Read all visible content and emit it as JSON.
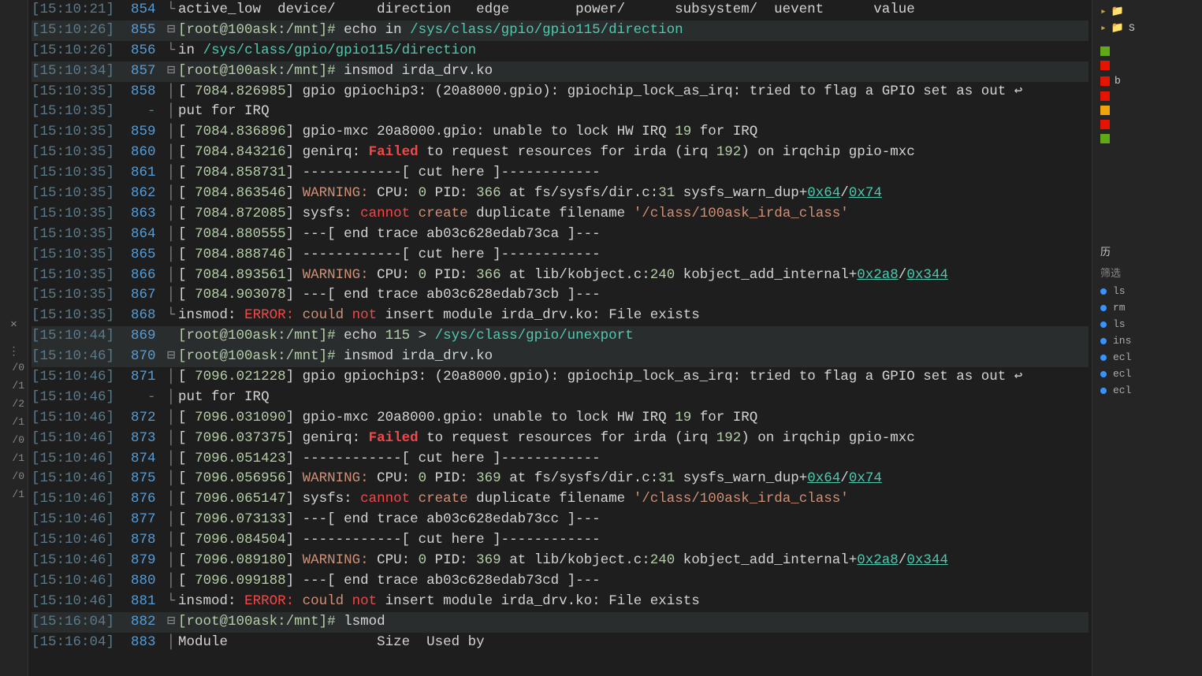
{
  "leftbar": {
    "close": "✕",
    "dots": "⋮",
    "items": [
      "/0",
      "/1",
      "/2",
      "/1",
      "/0",
      "/1",
      "/0",
      "/1"
    ]
  },
  "lines": [
    {
      "ts": "[15:10:21]",
      "ln": "854",
      "fold": "└",
      "segs": [
        {
          "t": "active_low  device/     direction   edge        power/      subsystem/  uevent      value",
          "c": "cmd"
        }
      ]
    },
    {
      "ts": "[15:10:26]",
      "ln": "855",
      "fold": "⊟",
      "hl": true,
      "segs": [
        {
          "t": "[root@100ask:/mnt]#",
          "c": "prompt"
        },
        {
          "t": " echo in ",
          "c": "cmd"
        },
        {
          "t": "/sys/class/gpio/gpio115/direction",
          "c": "path"
        }
      ]
    },
    {
      "ts": "[15:10:26]",
      "ln": "856",
      "fold": "└",
      "segs": [
        {
          "t": "in ",
          "c": "cmd"
        },
        {
          "t": "/sys/class/gpio/gpio115/direction",
          "c": "path"
        }
      ]
    },
    {
      "ts": "[15:10:34]",
      "ln": "857",
      "fold": "⊟",
      "hl": true,
      "segs": [
        {
          "t": "[root@100ask:/mnt]#",
          "c": "prompt"
        },
        {
          "t": " insmod irda_drv.ko",
          "c": "cmd"
        }
      ]
    },
    {
      "ts": "[15:10:35]",
      "ln": "858",
      "fold": "│",
      "segs": [
        {
          "t": "[ ",
          "c": "cmd"
        },
        {
          "t": "7084.826985",
          "c": "n"
        },
        {
          "t": "] gpio gpiochip3: (20a8000.gpio): gpiochip_lock_as_irq: tried to flag a GPIO set as out ↩",
          "c": "cmd"
        }
      ]
    },
    {
      "ts": "[15:10:35]",
      "ln": "-",
      "fold": "│",
      "segs": [
        {
          "t": "put for IRQ",
          "c": "cmd"
        }
      ]
    },
    {
      "ts": "[15:10:35]",
      "ln": "859",
      "fold": "│",
      "segs": [
        {
          "t": "[ ",
          "c": "cmd"
        },
        {
          "t": "7084.836896",
          "c": "n"
        },
        {
          "t": "] gpio-mxc 20a8000.gpio: unable to lock HW IRQ ",
          "c": "cmd"
        },
        {
          "t": "19",
          "c": "n"
        },
        {
          "t": " for IRQ",
          "c": "cmd"
        }
      ]
    },
    {
      "ts": "[15:10:35]",
      "ln": "860",
      "fold": "│",
      "segs": [
        {
          "t": "[ ",
          "c": "cmd"
        },
        {
          "t": "7084.843216",
          "c": "n"
        },
        {
          "t": "] genirq: ",
          "c": "cmd"
        },
        {
          "t": "Failed",
          "c": "kw-fail"
        },
        {
          "t": " to request resources for irda (irq ",
          "c": "cmd"
        },
        {
          "t": "192",
          "c": "n"
        },
        {
          "t": ") on irqchip gpio-mxc",
          "c": "cmd"
        }
      ]
    },
    {
      "ts": "[15:10:35]",
      "ln": "861",
      "fold": "│",
      "segs": [
        {
          "t": "[ ",
          "c": "cmd"
        },
        {
          "t": "7084.858731",
          "c": "n"
        },
        {
          "t": "] ------------[ cut here ]------------",
          "c": "cmd"
        }
      ]
    },
    {
      "ts": "[15:10:35]",
      "ln": "862",
      "fold": "│",
      "segs": [
        {
          "t": "[ ",
          "c": "cmd"
        },
        {
          "t": "7084.863546",
          "c": "n"
        },
        {
          "t": "] ",
          "c": "cmd"
        },
        {
          "t": "WARNING:",
          "c": "kw-warn"
        },
        {
          "t": " CPU: ",
          "c": "cmd"
        },
        {
          "t": "0",
          "c": "n"
        },
        {
          "t": " PID: ",
          "c": "cmd"
        },
        {
          "t": "366",
          "c": "n"
        },
        {
          "t": " at fs/sysfs/dir.c:",
          "c": "cmd"
        },
        {
          "t": "31",
          "c": "n"
        },
        {
          "t": " sysfs_warn_dup+",
          "c": "cmd"
        },
        {
          "t": "0x64",
          "c": "addr"
        },
        {
          "t": "/",
          "c": "cmd"
        },
        {
          "t": "0x74",
          "c": "addr"
        }
      ]
    },
    {
      "ts": "[15:10:35]",
      "ln": "863",
      "fold": "│",
      "segs": [
        {
          "t": "[ ",
          "c": "cmd"
        },
        {
          "t": "7084.872085",
          "c": "n"
        },
        {
          "t": "] sysfs: ",
          "c": "cmd"
        },
        {
          "t": "cannot",
          "c": "kw-cannot"
        },
        {
          "t": " ",
          "c": "cmd"
        },
        {
          "t": "create",
          "c": "kw-create"
        },
        {
          "t": " duplicate filename ",
          "c": "cmd"
        },
        {
          "t": "'/class/100ask_irda_class'",
          "c": "str"
        }
      ]
    },
    {
      "ts": "[15:10:35]",
      "ln": "864",
      "fold": "│",
      "segs": [
        {
          "t": "[ ",
          "c": "cmd"
        },
        {
          "t": "7084.880555",
          "c": "n"
        },
        {
          "t": "] ---[ end trace ab03c628edab73ca ]---",
          "c": "cmd"
        }
      ]
    },
    {
      "ts": "[15:10:35]",
      "ln": "865",
      "fold": "│",
      "segs": [
        {
          "t": "[ ",
          "c": "cmd"
        },
        {
          "t": "7084.888746",
          "c": "n"
        },
        {
          "t": "] ------------[ cut here ]------------",
          "c": "cmd"
        }
      ]
    },
    {
      "ts": "[15:10:35]",
      "ln": "866",
      "fold": "│",
      "segs": [
        {
          "t": "[ ",
          "c": "cmd"
        },
        {
          "t": "7084.893561",
          "c": "n"
        },
        {
          "t": "] ",
          "c": "cmd"
        },
        {
          "t": "WARNING:",
          "c": "kw-warn"
        },
        {
          "t": " CPU: ",
          "c": "cmd"
        },
        {
          "t": "0",
          "c": "n"
        },
        {
          "t": " PID: ",
          "c": "cmd"
        },
        {
          "t": "366",
          "c": "n"
        },
        {
          "t": " at lib/kobject.c:",
          "c": "cmd"
        },
        {
          "t": "240",
          "c": "n"
        },
        {
          "t": " kobject_add_internal+",
          "c": "cmd"
        },
        {
          "t": "0x2a8",
          "c": "addr"
        },
        {
          "t": "/",
          "c": "cmd"
        },
        {
          "t": "0x344",
          "c": "addr"
        }
      ]
    },
    {
      "ts": "[15:10:35]",
      "ln": "867",
      "fold": "│",
      "segs": [
        {
          "t": "[ ",
          "c": "cmd"
        },
        {
          "t": "7084.903078",
          "c": "n"
        },
        {
          "t": "] ---[ end trace ab03c628edab73cb ]---",
          "c": "cmd"
        }
      ]
    },
    {
      "ts": "[15:10:35]",
      "ln": "868",
      "fold": "└",
      "segs": [
        {
          "t": "insmod: ",
          "c": "cmd"
        },
        {
          "t": "ERROR:",
          "c": "kw-err"
        },
        {
          "t": " ",
          "c": "cmd"
        },
        {
          "t": "could",
          "c": "kw-could"
        },
        {
          "t": " ",
          "c": "cmd"
        },
        {
          "t": "not",
          "c": "kw-not"
        },
        {
          "t": " insert module irda_drv.ko: File exists",
          "c": "cmd"
        }
      ]
    },
    {
      "ts": "[15:10:44]",
      "ln": "869",
      "fold": " ",
      "hl": true,
      "segs": [
        {
          "t": "[root@100ask:/mnt]#",
          "c": "prompt"
        },
        {
          "t": " echo ",
          "c": "cmd"
        },
        {
          "t": "115",
          "c": "n"
        },
        {
          "t": " > ",
          "c": "cmd"
        },
        {
          "t": "/sys/class/gpio/unexport",
          "c": "path"
        }
      ]
    },
    {
      "ts": "[15:10:46]",
      "ln": "870",
      "fold": "⊟",
      "hl": true,
      "segs": [
        {
          "t": "[root@100ask:/mnt]#",
          "c": "prompt"
        },
        {
          "t": " insmod irda_drv.ko",
          "c": "cmd"
        }
      ]
    },
    {
      "ts": "[15:10:46]",
      "ln": "871",
      "fold": "│",
      "segs": [
        {
          "t": "[ ",
          "c": "cmd"
        },
        {
          "t": "7096.021228",
          "c": "n"
        },
        {
          "t": "] gpio gpiochip3: (20a8000.gpio): gpiochip_lock_as_irq: tried to flag a GPIO set as out ↩",
          "c": "cmd"
        }
      ]
    },
    {
      "ts": "[15:10:46]",
      "ln": "-",
      "fold": "│",
      "segs": [
        {
          "t": "put for IRQ",
          "c": "cmd"
        }
      ]
    },
    {
      "ts": "[15:10:46]",
      "ln": "872",
      "fold": "│",
      "segs": [
        {
          "t": "[ ",
          "c": "cmd"
        },
        {
          "t": "7096.031090",
          "c": "n"
        },
        {
          "t": "] gpio-mxc 20a8000.gpio: unable to lock HW IRQ ",
          "c": "cmd"
        },
        {
          "t": "19",
          "c": "n"
        },
        {
          "t": " for IRQ",
          "c": "cmd"
        }
      ]
    },
    {
      "ts": "[15:10:46]",
      "ln": "873",
      "fold": "│",
      "segs": [
        {
          "t": "[ ",
          "c": "cmd"
        },
        {
          "t": "7096.037375",
          "c": "n"
        },
        {
          "t": "] genirq: ",
          "c": "cmd"
        },
        {
          "t": "Failed",
          "c": "kw-fail"
        },
        {
          "t": " to request resources for irda (irq ",
          "c": "cmd"
        },
        {
          "t": "192",
          "c": "n"
        },
        {
          "t": ") on irqchip gpio-mxc",
          "c": "cmd"
        }
      ]
    },
    {
      "ts": "[15:10:46]",
      "ln": "874",
      "fold": "│",
      "segs": [
        {
          "t": "[ ",
          "c": "cmd"
        },
        {
          "t": "7096.051423",
          "c": "n"
        },
        {
          "t": "] ------------[ cut here ]------------",
          "c": "cmd"
        }
      ]
    },
    {
      "ts": "[15:10:46]",
      "ln": "875",
      "fold": "│",
      "segs": [
        {
          "t": "[ ",
          "c": "cmd"
        },
        {
          "t": "7096.056956",
          "c": "n"
        },
        {
          "t": "] ",
          "c": "cmd"
        },
        {
          "t": "WARNING:",
          "c": "kw-warn"
        },
        {
          "t": " CPU: ",
          "c": "cmd"
        },
        {
          "t": "0",
          "c": "n"
        },
        {
          "t": " PID: ",
          "c": "cmd"
        },
        {
          "t": "369",
          "c": "n"
        },
        {
          "t": " at fs/sysfs/dir.c:",
          "c": "cmd"
        },
        {
          "t": "31",
          "c": "n"
        },
        {
          "t": " sysfs_warn_dup+",
          "c": "cmd"
        },
        {
          "t": "0x64",
          "c": "addr"
        },
        {
          "t": "/",
          "c": "cmd"
        },
        {
          "t": "0x74",
          "c": "addr"
        }
      ]
    },
    {
      "ts": "[15:10:46]",
      "ln": "876",
      "fold": "│",
      "segs": [
        {
          "t": "[ ",
          "c": "cmd"
        },
        {
          "t": "7096.065147",
          "c": "n"
        },
        {
          "t": "] sysfs: ",
          "c": "cmd"
        },
        {
          "t": "cannot",
          "c": "kw-cannot"
        },
        {
          "t": " ",
          "c": "cmd"
        },
        {
          "t": "create",
          "c": "kw-create"
        },
        {
          "t": " duplicate filename ",
          "c": "cmd"
        },
        {
          "t": "'/class/100ask_irda_class'",
          "c": "str"
        }
      ]
    },
    {
      "ts": "[15:10:46]",
      "ln": "877",
      "fold": "│",
      "segs": [
        {
          "t": "[ ",
          "c": "cmd"
        },
        {
          "t": "7096.073133",
          "c": "n"
        },
        {
          "t": "] ---[ end trace ab03c628edab73cc ]---",
          "c": "cmd"
        }
      ]
    },
    {
      "ts": "[15:10:46]",
      "ln": "878",
      "fold": "│",
      "segs": [
        {
          "t": "[ ",
          "c": "cmd"
        },
        {
          "t": "7096.084504",
          "c": "n"
        },
        {
          "t": "] ------------[ cut here ]------------",
          "c": "cmd"
        }
      ]
    },
    {
      "ts": "[15:10:46]",
      "ln": "879",
      "fold": "│",
      "segs": [
        {
          "t": "[ ",
          "c": "cmd"
        },
        {
          "t": "7096.089180",
          "c": "n"
        },
        {
          "t": "] ",
          "c": "cmd"
        },
        {
          "t": "WARNING:",
          "c": "kw-warn"
        },
        {
          "t": " CPU: ",
          "c": "cmd"
        },
        {
          "t": "0",
          "c": "n"
        },
        {
          "t": " PID: ",
          "c": "cmd"
        },
        {
          "t": "369",
          "c": "n"
        },
        {
          "t": " at lib/kobject.c:",
          "c": "cmd"
        },
        {
          "t": "240",
          "c": "n"
        },
        {
          "t": " kobject_add_internal+",
          "c": "cmd"
        },
        {
          "t": "0x2a8",
          "c": "addr"
        },
        {
          "t": "/",
          "c": "cmd"
        },
        {
          "t": "0x344",
          "c": "addr"
        }
      ]
    },
    {
      "ts": "[15:10:46]",
      "ln": "880",
      "fold": "│",
      "segs": [
        {
          "t": "[ ",
          "c": "cmd"
        },
        {
          "t": "7096.099188",
          "c": "n"
        },
        {
          "t": "] ---[ end trace ab03c628edab73cd ]---",
          "c": "cmd"
        }
      ]
    },
    {
      "ts": "[15:10:46]",
      "ln": "881",
      "fold": "└",
      "segs": [
        {
          "t": "insmod: ",
          "c": "cmd"
        },
        {
          "t": "ERROR:",
          "c": "kw-err"
        },
        {
          "t": " ",
          "c": "cmd"
        },
        {
          "t": "could",
          "c": "kw-could"
        },
        {
          "t": " ",
          "c": "cmd"
        },
        {
          "t": "not",
          "c": "kw-not"
        },
        {
          "t": " insert module irda_drv.ko: File exists",
          "c": "cmd"
        }
      ]
    },
    {
      "ts": "[15:16:04]",
      "ln": "882",
      "fold": "⊟",
      "hl": true,
      "segs": [
        {
          "t": "[root@100ask:/mnt]#",
          "c": "prompt"
        },
        {
          "t": " lsmod",
          "c": "cmd"
        }
      ]
    },
    {
      "ts": "[15:16:04]",
      "ln": "883",
      "fold": "│",
      "segs": [
        {
          "t": "Module                  Size  Used by",
          "c": "cmd"
        }
      ]
    }
  ],
  "right": {
    "folders": [
      {
        "t": " "
      },
      {
        "t": "S"
      }
    ],
    "squares": [
      [
        "green",
        " "
      ],
      [
        "red",
        " "
      ],
      [
        "red",
        "b"
      ],
      [
        "red",
        " "
      ],
      [
        "yellow",
        " "
      ],
      [
        "red",
        " "
      ],
      [
        "green",
        " "
      ]
    ],
    "history_hdr": "历",
    "filter": "筛选",
    "history": [
      "ls",
      "rm",
      "ls",
      "ins",
      "ecl",
      "ecl",
      "ecl"
    ]
  }
}
